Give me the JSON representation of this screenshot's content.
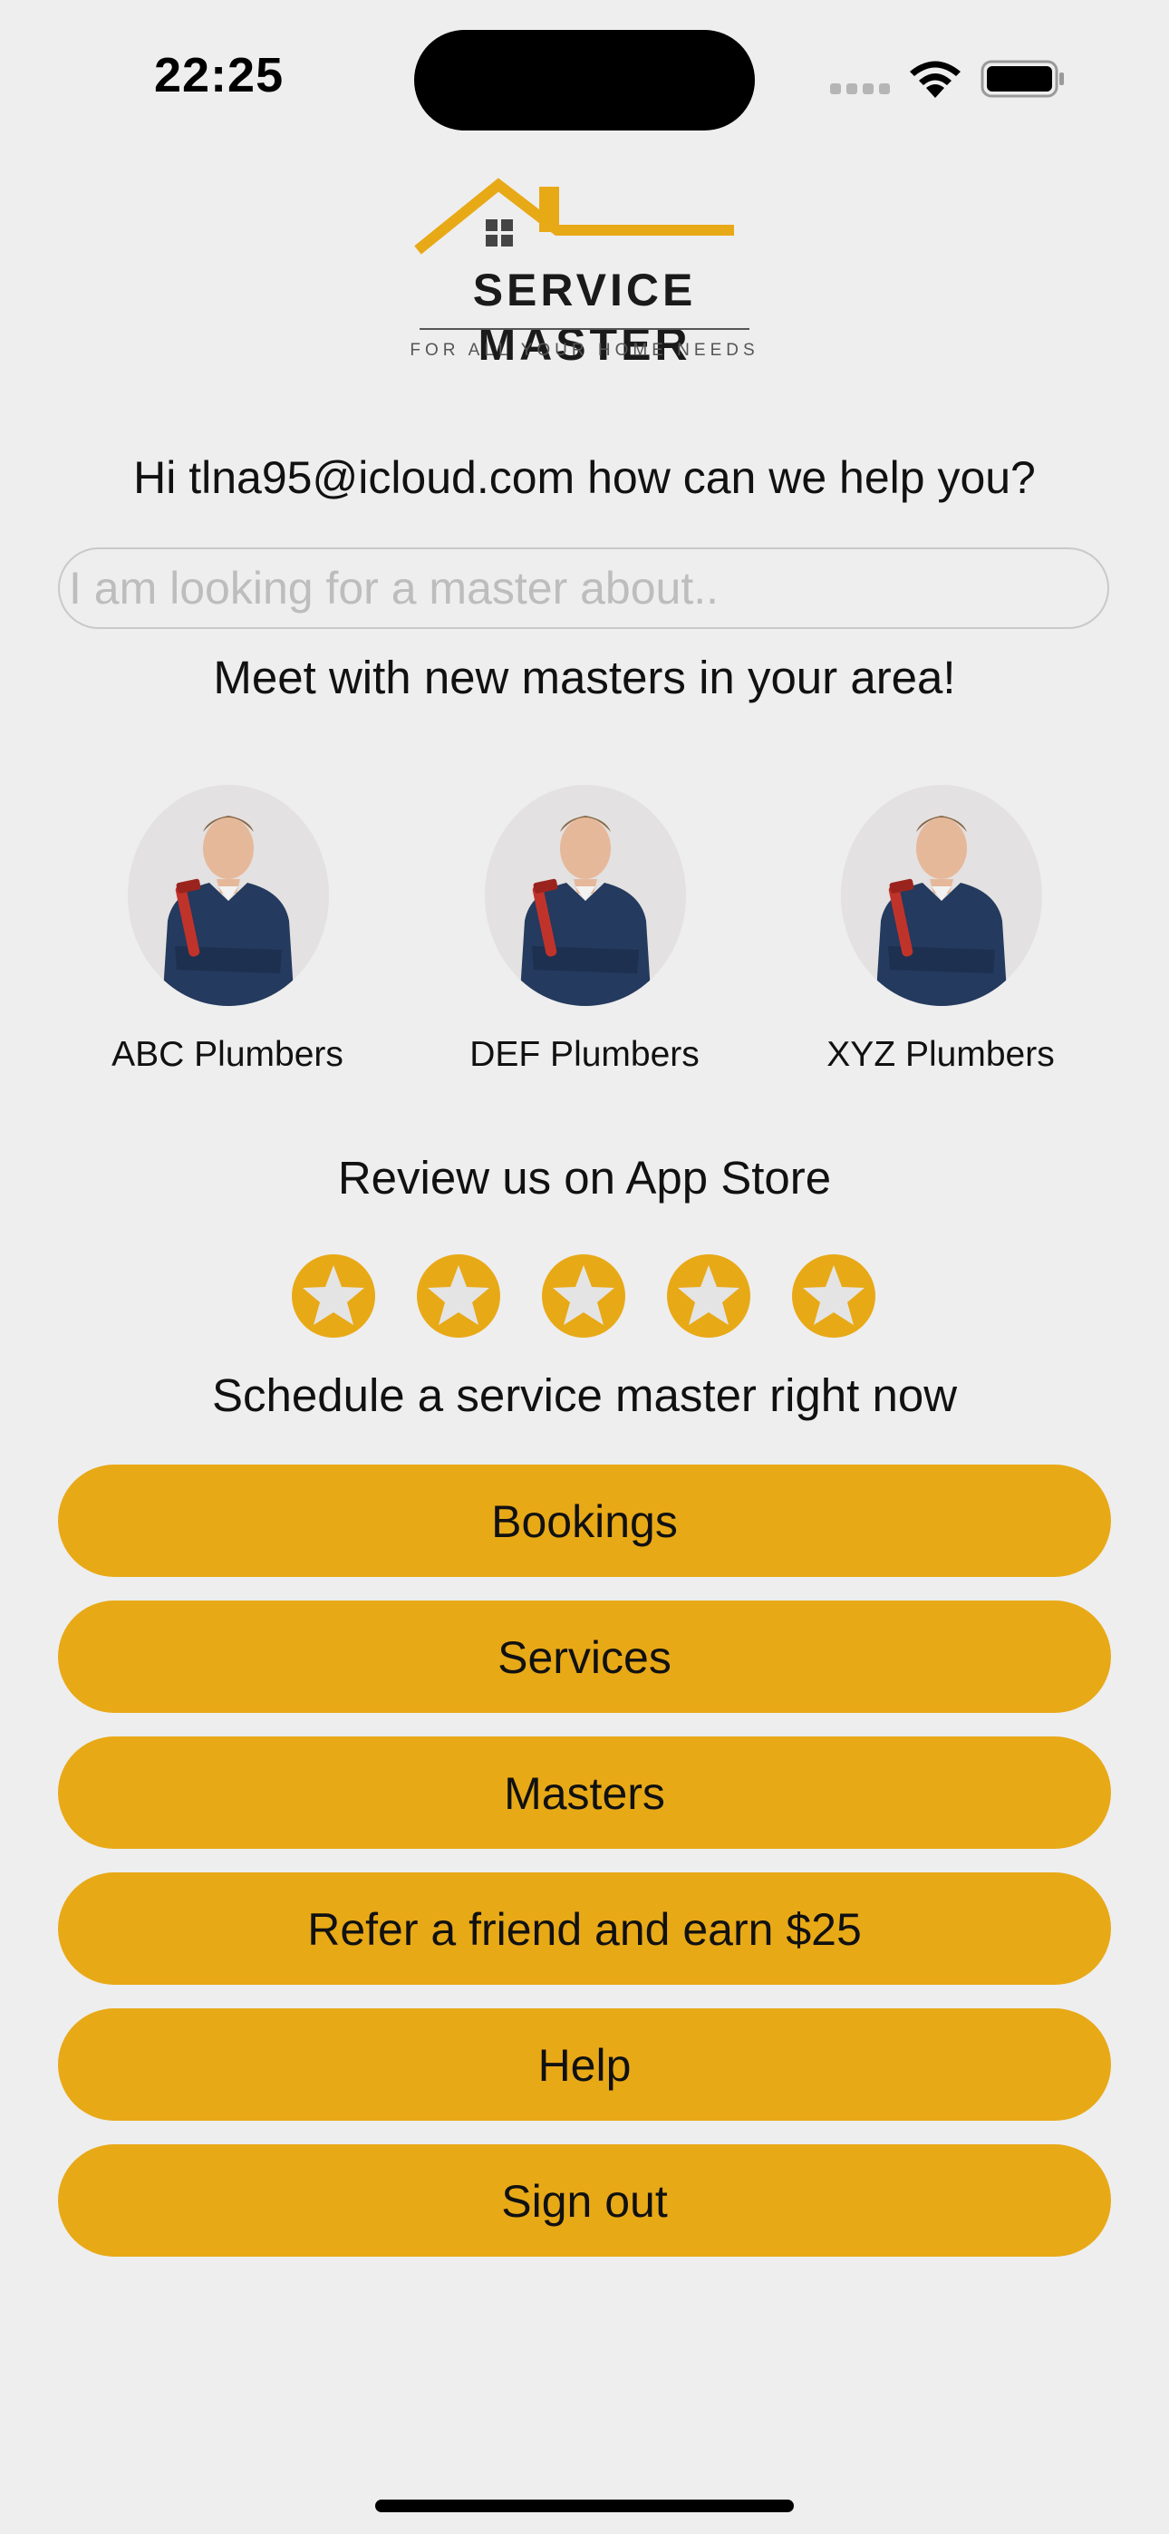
{
  "status_bar": {
    "time": "22:25"
  },
  "logo": {
    "title": "SERVICE MASTER",
    "tagline": "FOR ALL YOUR HOME NEEDS"
  },
  "greeting": "Hi tlna95@icloud.com how can we help you?",
  "search": {
    "placeholder": "I am looking for a master about..",
    "value": ""
  },
  "masters": {
    "heading": "Meet with new masters in your area!",
    "items": [
      {
        "name": "ABC Plumbers"
      },
      {
        "name": "DEF Plumbers"
      },
      {
        "name": "XYZ Plumbers"
      }
    ]
  },
  "review": {
    "heading": "Review us on App Store",
    "star_count": 5
  },
  "schedule": {
    "heading": "Schedule a service master right now"
  },
  "actions": {
    "bookings": "Bookings",
    "services": "Services",
    "masters": "Masters",
    "refer": "Refer a friend and earn $25",
    "help": "Help",
    "sign_out": "Sign out"
  },
  "colors": {
    "background": "#eeeeee",
    "accent": "#e8a917",
    "text": "#111111"
  },
  "icons": [
    "signal-icon",
    "wifi-icon",
    "battery-icon",
    "house-roof-icon",
    "star-icon",
    "plumber-avatar"
  ]
}
